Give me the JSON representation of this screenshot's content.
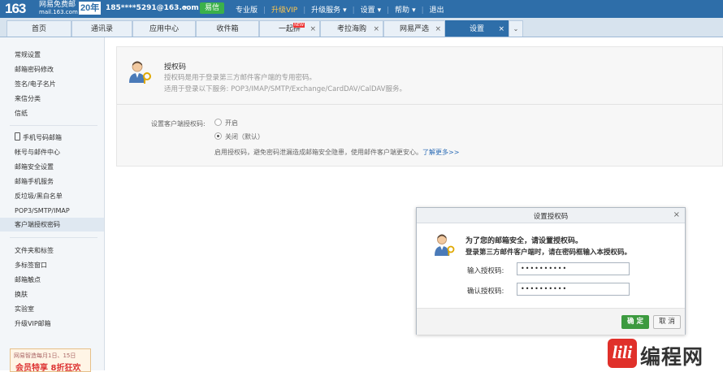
{
  "topbar": {
    "logo_number": "163",
    "logo_brand": "网易免费邮",
    "logo_domain": "mail.163.com",
    "anniversary": "20年",
    "account": "185****5291@163.com",
    "yixin": "易信",
    "links": [
      "专业版",
      "升级VIP",
      "升级服务",
      "设置",
      "帮助",
      "退出"
    ]
  },
  "tabs": [
    {
      "label": "首页"
    },
    {
      "label": "通讯录"
    },
    {
      "label": "应用中心"
    },
    {
      "label": "收件箱"
    },
    {
      "label": "一起拼",
      "badge": "NEW"
    },
    {
      "label": "考拉海购"
    },
    {
      "label": "网易严选"
    },
    {
      "label": "设置"
    }
  ],
  "sidebar": {
    "items": [
      "常规设置",
      "邮箱密码修改",
      "签名/电子名片",
      "来信分类",
      "信纸",
      "手机号码邮箱",
      "帐号与邮件中心",
      "邮箱安全设置",
      "邮箱手机服务",
      "反垃圾/黑白名单",
      "POP3/SMTP/IMAP",
      "客户端授权密码",
      "文件夹和标签",
      "多标签窗口",
      "邮箱触点",
      "换肤",
      "实验室",
      "升级VIP邮箱"
    ],
    "promo_line1": "网易智造每月1日、15日",
    "promo_line2": "会员特享 8折狂欢"
  },
  "panel": {
    "title": "授权码",
    "desc1": "授权码是用于登录第三方邮件客户端的专用密码。",
    "desc2": "适用于登录以下服务: POP3/IMAP/SMTP/Exchange/CardDAV/CalDAV服务。",
    "field_label": "设置客户端授权码:",
    "option_on": "开启",
    "option_off": "关闭（默认）",
    "tip": "启用授权码，避免密码泄漏造成邮箱安全隐患，使用邮件客户端更安心。",
    "learn_more": "了解更多>>"
  },
  "dialog": {
    "title": "设置授权码",
    "close": "×",
    "msg1": "为了您的邮箱安全，请设置授权码。",
    "msg2": "登录第三方邮件客户端时，请在密码框输入本授权码。",
    "label1": "输入授权码:",
    "value1": "••••••••••",
    "label2": "确认授权码:",
    "value2": "••••••••••",
    "ok": "确 定",
    "cancel": "取 消"
  },
  "watermark": {
    "mark": "lili",
    "text": "编程网"
  },
  "colors": {
    "topbar": "#2e6ea9",
    "ok_button": "#3c9a3f",
    "link": "#2b6bb5"
  }
}
